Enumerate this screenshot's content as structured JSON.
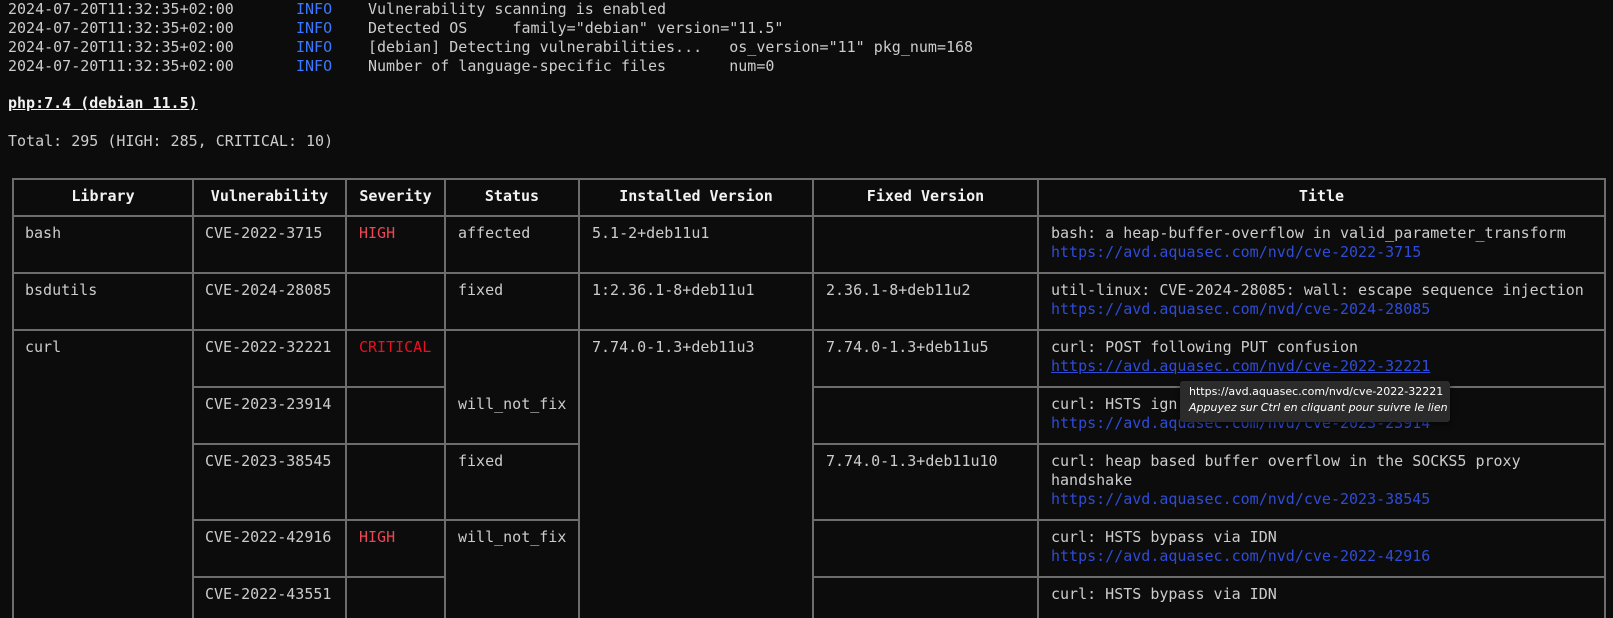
{
  "log": [
    {
      "ts": "2024-07-20T11:32:35+02:00",
      "level": "INFO",
      "msg": "Vulnerability scanning is enabled"
    },
    {
      "ts": "2024-07-20T11:32:35+02:00",
      "level": "INFO",
      "msg": "Detected OS     family=\"debian\" version=\"11.5\""
    },
    {
      "ts": "2024-07-20T11:32:35+02:00",
      "level": "INFO",
      "msg": "[debian] Detecting vulnerabilities...   os_version=\"11\" pkg_num=168"
    },
    {
      "ts": "2024-07-20T11:32:35+02:00",
      "level": "INFO",
      "msg": "Number of language-specific files       num=0"
    }
  ],
  "target": "php:7.4 (debian 11.5)",
  "total": "Total: 295 (HIGH: 285, CRITICAL: 10)",
  "table": {
    "headers": [
      "Library",
      "Vulnerability",
      "Severity",
      "Status",
      "Installed Version",
      "Fixed Version",
      "Title"
    ],
    "libraries": [
      "bash",
      "bsdutils",
      "curl"
    ],
    "vulns": [
      "CVE-2022-3715",
      "CVE-2024-28085",
      "CVE-2022-32221",
      "CVE-2023-23914",
      "CVE-2023-38545",
      "CVE-2022-42916",
      "CVE-2022-43551"
    ],
    "severities": [
      "HIGH",
      "CRITICAL",
      "HIGH"
    ],
    "statuses": [
      "affected",
      "fixed",
      "will_not_fix",
      "fixed",
      "will_not_fix"
    ],
    "installed": [
      "5.1-2+deb11u1",
      "1:2.36.1-8+deb11u1",
      "7.74.0-1.3+deb11u3"
    ],
    "fixed": [
      "2.36.1-8+deb11u2",
      "7.74.0-1.3+deb11u5",
      "7.74.0-1.3+deb11u10"
    ],
    "titles": [
      {
        "text": "bash: a heap-buffer-overflow in valid_parameter_transform",
        "link": "https://avd.aquasec.com/nvd/cve-2022-3715"
      },
      {
        "text": "util-linux: CVE-2024-28085: wall: escape sequence injection",
        "link": "https://avd.aquasec.com/nvd/cve-2024-28085"
      },
      {
        "text": "curl: POST following PUT confusion",
        "link": "https://avd.aquasec.com/nvd/cve-2022-32221"
      },
      {
        "text": "curl: HSTS ign",
        "link": "https://avd.aquasec.com/nvd/cve-2023-23914"
      },
      {
        "text": "curl: heap based buffer overflow in the SOCKS5 proxy",
        "text2": "handshake",
        "link": "https://avd.aquasec.com/nvd/cve-2023-38545"
      },
      {
        "text": "curl: HSTS bypass via IDN",
        "link": "https://avd.aquasec.com/nvd/cve-2022-42916"
      },
      {
        "text": "curl: HSTS bypass via IDN"
      }
    ]
  },
  "tooltip": {
    "url": "https://avd.aquasec.com/nvd/cve-2022-32221",
    "hint": "Appuyez sur Ctrl en cliquant pour suivre le lien"
  },
  "colors": {
    "info": "#3b78ff",
    "high": "#e74856",
    "critical": "#e81123",
    "link": "#2f4cd6"
  }
}
